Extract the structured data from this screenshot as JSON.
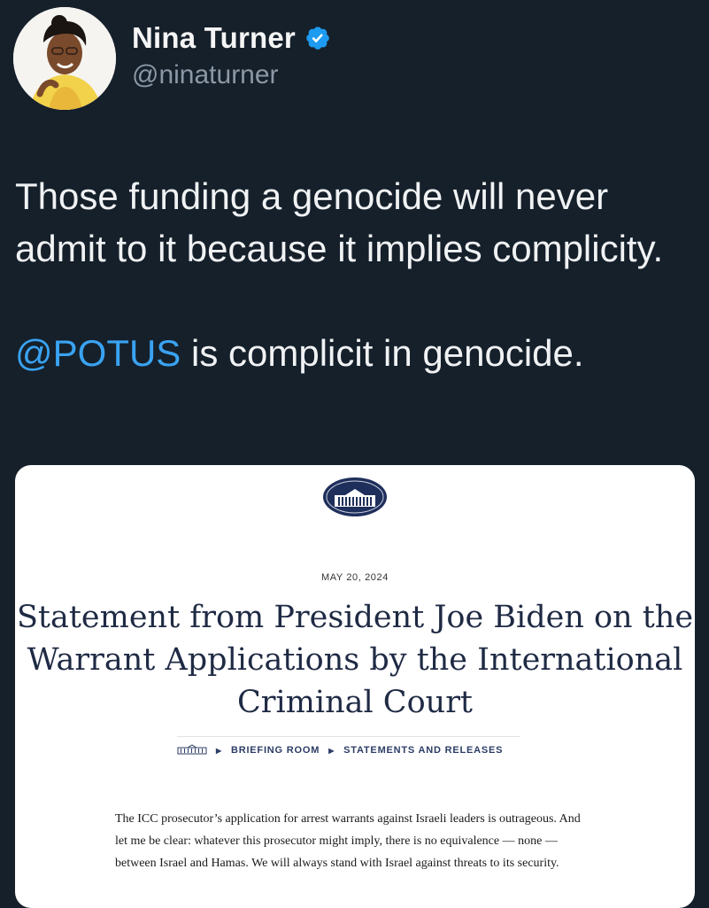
{
  "author": {
    "display_name": "Nina Turner",
    "handle": "@ninaturner",
    "verified": true,
    "verified_color": "#1d9bf0",
    "avatar_icon": "profile-photo"
  },
  "tweet": {
    "line1": "Those funding a genocide will never admit to it because it implies complicity.",
    "mention": "@POTUS",
    "line2_rest": " is complicit in genocide.",
    "mention_color": "#3aa3f2"
  },
  "card": {
    "seal_icon": "white-house-seal-icon",
    "date": "MAY 20, 2024",
    "headline": "Statement from President Joe Biden on the Warrant Applications by the International Criminal Court",
    "breadcrumb": {
      "home_icon": "white-house-icon",
      "items": [
        "BRIEFING ROOM",
        "STATEMENTS AND RELEASES"
      ]
    },
    "body": "The ICC prosecutor’s application for arrest warrants against Israeli leaders is outrageous. And let me be clear: whatever this prosecutor might imply, there is no equivalence — none — between Israel and Hamas.  We will always stand with Israel against threats to its security."
  },
  "colors": {
    "background": "#15202b",
    "text": "#e7e9ea",
    "muted": "#8b98a5",
    "headline": "#1f2a44"
  }
}
